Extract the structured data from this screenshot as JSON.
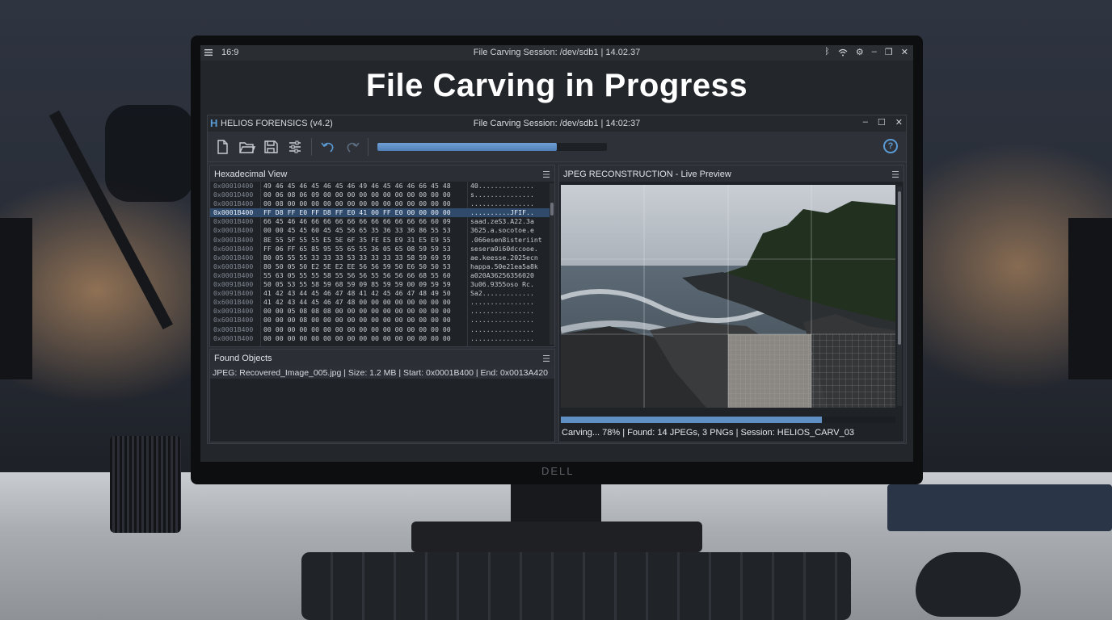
{
  "os_bar": {
    "ratio": "16:9",
    "title": "File Carving Session: /dev/sdb1 | 14.02.37",
    "tray_icons": [
      "bluetooth-icon",
      "wifi-icon",
      "settings-icon",
      "minimize-icon",
      "restore-icon",
      "close-icon"
    ]
  },
  "headline": "File Carving in Progress",
  "app": {
    "name": "HELIOS FORENSICS (v4.2)",
    "logo": "H",
    "session_title": "File Carving Session: /dev/sdb1 | 14:02:37",
    "toolbar_icons": [
      "new-file-icon",
      "open-folder-icon",
      "save-icon",
      "settings-sliders-icon",
      "undo-icon",
      "redo-icon",
      "help-icon"
    ],
    "progress": 0.78
  },
  "hex_view": {
    "title": "Hexadecimal View",
    "rows": [
      {
        "offset": "0x00010400",
        "bytes": "49 46 45 46 45 46 45 46 49 46 45 46 46 66 45 48",
        "ascii": "40..............",
        "selected": false
      },
      {
        "offset": "0x0001D400",
        "bytes": "00 06 08 06 09 00 00 00 00 00 00 00 00 00 00 00",
        "ascii": "s...............",
        "selected": false
      },
      {
        "offset": "0x0001B400",
        "bytes": "00 08 00 00 00 00 00 00 00 00 00 00 00 00 00 00",
        "ascii": "................",
        "selected": false
      },
      {
        "offset": "0x0001B400",
        "bytes": "FF D8 FF E0 FF D8 FF E0 41 00 FF E0 00 00 00 00",
        "ascii": "..........JFIF..",
        "selected": true
      },
      {
        "offset": "0x0001B400",
        "bytes": "66 45 46 46 66 66 66 66 66 66 66 66 66 66 60 09",
        "ascii": "saad.zeS3.A22.3a",
        "selected": false
      },
      {
        "offset": "0x0001B400",
        "bytes": "00 00 45 45 60 45 45 56 65 35 36 33 36 86 55 53",
        "ascii": "3625.a.socotoe.e",
        "selected": false
      },
      {
        "offset": "0x0001B400",
        "bytes": "8E 55 5F 55 55 E5 5E 6F 35 FE E5 E9 31 E5 E9 55",
        "ascii": ".066esen8isteriint",
        "selected": false
      },
      {
        "offset": "0x6001B400",
        "bytes": "FF 06 FF 65 85 95 55 65 55 36 05 65 08 59 59 53",
        "ascii": "sesera0i60dccooe.",
        "selected": false
      },
      {
        "offset": "0x0001B400",
        "bytes": "B0 05 55 55 33 33 33 53 33 33 33 33 58 59 69 59",
        "ascii": "ae.keesse.2025ecn",
        "selected": false
      },
      {
        "offset": "0x6001B400",
        "bytes": "80 50 05 50 E2 5E E2 EE 56 56 59 50 E6 50 50 53",
        "ascii": "happa.50e21ea5a8k",
        "selected": false
      },
      {
        "offset": "0x0001B400",
        "bytes": "55 63 05 55 55 58 55 56 56 55 56 56 66 68 55 60",
        "ascii": "a020A36256356020",
        "selected": false
      },
      {
        "offset": "0x0091B400",
        "bytes": "50 05 53 55 58 59 68 59 09 85 59 59 00 09 59 59",
        "ascii": "3u06.9355oso Rc.",
        "selected": false
      },
      {
        "offset": "0x0091B400",
        "bytes": "41 42 43 44 45 46 47 48 41 42 45 46 47 48 49 50",
        "ascii": "Sa2.............",
        "selected": false
      },
      {
        "offset": "0x6001B400",
        "bytes": "41 42 43 44 45 46 47 48 00 00 00 00 00 00 00 00",
        "ascii": "................",
        "selected": false
      },
      {
        "offset": "0x0091B400",
        "bytes": "00 00 05 08 08 08 00 00 00 00 00 00 00 00 00 00",
        "ascii": "................",
        "selected": false
      },
      {
        "offset": "0x6001B400",
        "bytes": "00 00 00 08 00 00 00 00 00 00 00 00 00 00 00 00",
        "ascii": "................",
        "selected": false
      },
      {
        "offset": "0x0001B400",
        "bytes": "00 00 00 00 00 00 00 00 00 00 00 00 00 00 00 00",
        "ascii": "................",
        "selected": false
      },
      {
        "offset": "0x0001B400",
        "bytes": "00 00 00 00 00 00 00 00 00 00 00 00 00 00 00 00",
        "ascii": "................",
        "selected": false
      }
    ]
  },
  "found_objects": {
    "title": "Found Objects",
    "items": [
      {
        "text": "JPEG: Recovered_Image_005.jpg | Size: 1.2 MB | Start: 0x0001B400 | End: 0x0013A420"
      }
    ]
  },
  "preview": {
    "title": "JPEG RECONSTRUCTION - Live Preview",
    "progress": 0.78,
    "status": "Carving... 78% | Found: 14 JPEGs, 3 PNGs | Session: HELIOS_CARV_03"
  },
  "monitor_brand": "DELL",
  "colors": {
    "accent": "#5b9bd5",
    "selection": "#2f4a6b",
    "panel_bg": "#1f2226"
  }
}
